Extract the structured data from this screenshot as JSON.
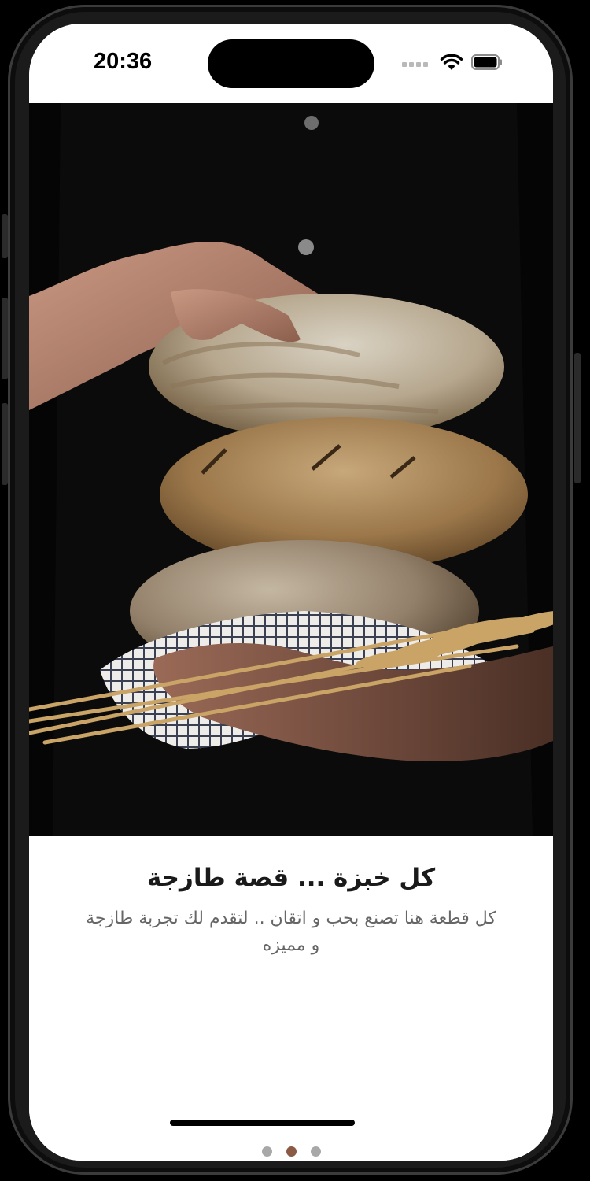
{
  "status_bar": {
    "time": "20:36"
  },
  "onboarding": {
    "title": "كل خبزة ... قصة طازجة",
    "description": "كل قطعة هنا تصنع بحب و اتقان .. لتقدم لك تجربة طازجة و مميزه",
    "page_count": 3,
    "current_page": 2,
    "icons": [
      "signal-icon",
      "wifi-icon",
      "battery-icon"
    ]
  },
  "colors": {
    "active_dot": "#8a5a44",
    "inactive_dot": "#a8a8a8",
    "title": "#1a1a1a",
    "description": "#666666"
  }
}
